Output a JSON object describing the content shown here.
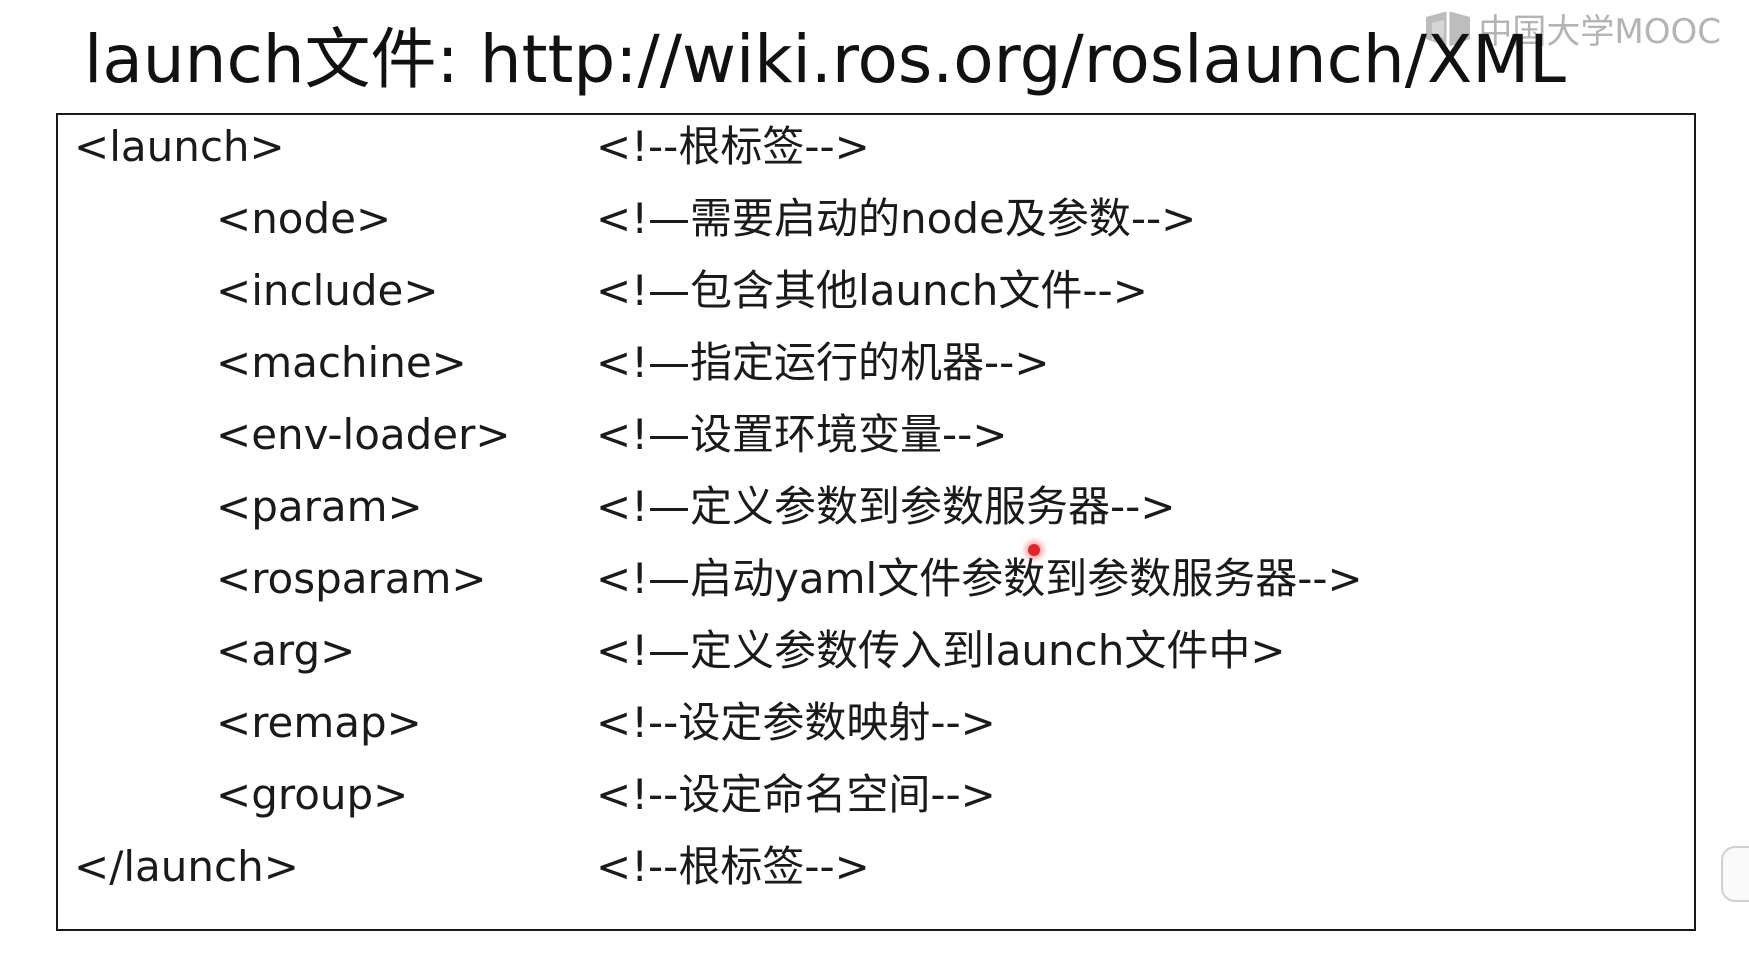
{
  "watermark": {
    "text": "中国大学MOOC",
    "icon": "mooc-logo-icon",
    "color": "#b4b4b4"
  },
  "slide": {
    "title": "launch文件: http://wiki.ros.org/roslaunch/XML"
  },
  "code": {
    "rows": [
      {
        "tag": "<launch>",
        "comment": "<!--根标签-->",
        "indent": 0
      },
      {
        "tag": "<node>",
        "comment": "<!—需要启动的node及参数-->",
        "indent": 1
      },
      {
        "tag": "<include>",
        "comment": "<!—包含其他launch文件-->",
        "indent": 1
      },
      {
        "tag": "<machine>",
        "comment": "<!—指定运行的机器-->",
        "indent": 1
      },
      {
        "tag": "<env-loader>",
        "comment": "<!—设置环境变量-->",
        "indent": 1
      },
      {
        "tag": "<param>",
        "comment": "<!—定义参数到参数服务器-->",
        "indent": 1
      },
      {
        "tag": "<rosparam>",
        "comment": "<!—启动yaml文件参数到参数服务器-->",
        "indent": 1
      },
      {
        "tag": "<arg>",
        "comment": "<!—定义参数传入到launch文件中>",
        "indent": 1
      },
      {
        "tag": "<remap>",
        "comment": "<!--设定参数映射-->",
        "indent": 1
      },
      {
        "tag": "<group>",
        "comment": "<!--设定命名空间-->",
        "indent": 1
      },
      {
        "tag": "</launch>",
        "comment": "<!--根标签-->",
        "indent": 0
      }
    ]
  },
  "colors": {
    "laser_pointer": "#e0242d",
    "border": "#1a1a1a"
  }
}
